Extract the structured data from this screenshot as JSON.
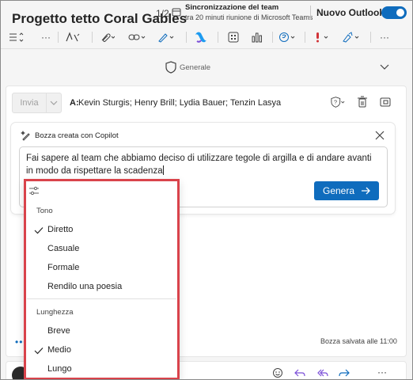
{
  "topbar": {
    "page_counter": "1/2",
    "notification_title": "Sincronizzazione del team",
    "notification_subtitle": "tra 20 minuti riunione di Microsoft Teams",
    "new_outlook_label": "Nuovo Outlook",
    "new_outlook_on": true
  },
  "toolbar": {
    "icons": [
      "text-format-icon",
      "more-icon",
      "format-painter-icon",
      "attach-icon",
      "link-icon",
      "draw-icon",
      "copilot-icon",
      "apps-icon",
      "chart-icon",
      "loop-icon",
      "importance-icon",
      "sensitivity-icon",
      "more-icon"
    ],
    "more_label": "···"
  },
  "subject": {
    "title": "Progetto tetto Coral Gables",
    "label": "Generale"
  },
  "compose": {
    "send_label": "Invia",
    "to_label": "A:",
    "to_value": "Kevin Sturgis; Henry Brill; Lydia Bauer; Tenzin Lasya",
    "saved_text": "Bozza salvata alle 11:00",
    "dots": "•••"
  },
  "copilot": {
    "title": "Bozza creata con Copilot",
    "prompt": "Fai sapere al team che abbiamo deciso di utilizzare tegole di argilla e di andare avanti in modo da rispettare la scadenza",
    "generate_label": "Genera"
  },
  "menu": {
    "tone_header": "Tono",
    "tone_options": [
      "Diretto",
      "Casuale",
      "Formale",
      "Rendilo una poesia"
    ],
    "tone_selected": "Diretto",
    "length_header": "Lunghezza",
    "length_options": [
      "Breve",
      "Medio",
      "Lungo"
    ],
    "length_selected": "Medio"
  },
  "colors": {
    "accent": "#0f6cbd",
    "highlight_border": "#d9434b"
  }
}
